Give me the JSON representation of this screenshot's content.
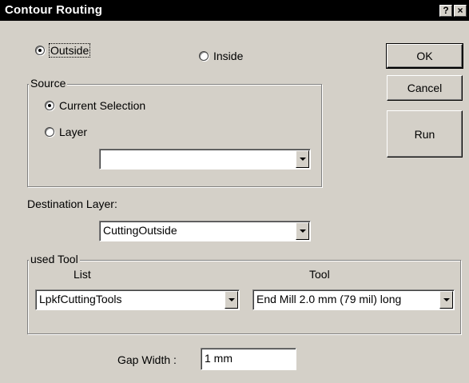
{
  "window": {
    "title": "Contour Routing",
    "help_label": "?",
    "close_label": "×"
  },
  "route_side": {
    "outside_label": "Outside",
    "outside_checked": true,
    "inside_label": "Inside",
    "inside_checked": false
  },
  "source": {
    "legend": "Source",
    "current_selection_label": "Current Selection",
    "current_selection_checked": true,
    "layer_label": "Layer",
    "layer_checked": false,
    "layer_value": ""
  },
  "destination": {
    "label": "Destination Layer:",
    "value": "CuttingOutside"
  },
  "used_tool": {
    "legend": "used Tool",
    "list_header": "List",
    "list_value": "LpkfCuttingTools",
    "tool_header": "Tool",
    "tool_value": "End Mill 2.0 mm (79 mil) long"
  },
  "gap": {
    "label": "Gap Width :",
    "value": "1 mm"
  },
  "buttons": {
    "ok": "OK",
    "cancel": "Cancel",
    "run": "Run"
  }
}
